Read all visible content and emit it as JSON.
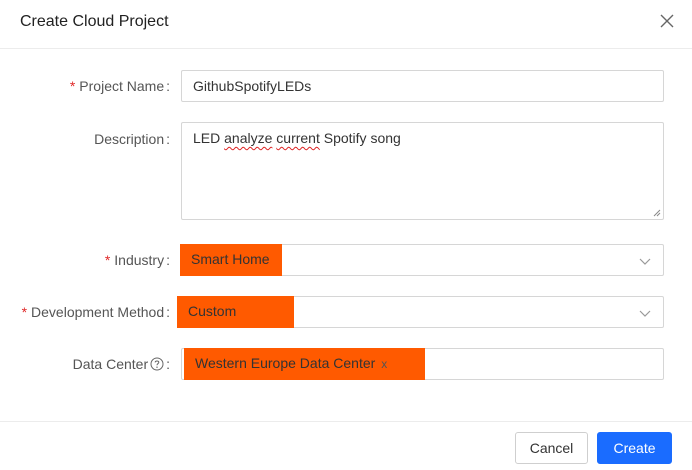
{
  "dialog": {
    "title": "Create Cloud Project",
    "close_icon": "close-icon"
  },
  "form": {
    "project_name": {
      "label": "Project Name",
      "required_mark": "*",
      "value": "GithubSpotifyLEDs"
    },
    "description": {
      "label": "Description",
      "value_plain_1": "LED ",
      "value_spell_1": "analyze",
      "value_plain_2": " ",
      "value_spell_2": "current",
      "value_plain_3": " Spotify song"
    },
    "industry": {
      "label": "Industry",
      "required_mark": "*",
      "value": "Smart Home"
    },
    "development_method": {
      "label": "Development Method",
      "required_mark": "*",
      "value": "Custom"
    },
    "data_center": {
      "label": "Data Center",
      "help_icon": "question-circle-icon",
      "selected_tag": "Western Europe Data Center",
      "tag_remove": "x"
    },
    "colon": ":"
  },
  "footer": {
    "cancel_label": "Cancel",
    "create_label": "Create"
  },
  "colors": {
    "primary": "#1a6cff",
    "required": "#e02828",
    "redaction": "#ff5a00"
  }
}
